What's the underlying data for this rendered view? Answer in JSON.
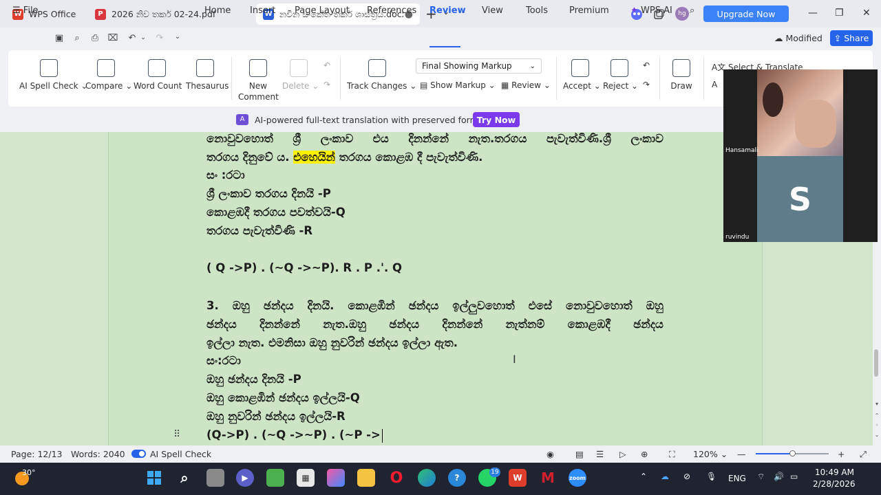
{
  "tabs": [
    {
      "label": "WPS Office",
      "icon": "wps-logo-icon",
      "color": "#e03e2d"
    },
    {
      "label": "2026 නිව තර්ක 02-24.pdf",
      "icon": "pdf-icon",
      "color": "#d9363e"
    },
    {
      "label": "නවීන සංකේත තර්ක ශාස්ත්‍රය.docx",
      "icon": "word-doc-icon",
      "color": "#2b5fd9",
      "active": true
    }
  ],
  "header": {
    "avatar_initials": "hg",
    "upgrade_label": "Upgrade Now"
  },
  "menu": {
    "file": "File",
    "items": [
      "Home",
      "Insert",
      "Page Layout",
      "References",
      "Review",
      "View",
      "Tools",
      "Premium"
    ],
    "active": "Review",
    "wps_ai": "WPS AI",
    "modified": "Modified",
    "share": "Share"
  },
  "ribbon": {
    "spell_check": "AI Spell Check",
    "compare": "Compare",
    "word_count": "Word Count",
    "thesaurus": "Thesaurus",
    "new_comment": "New\nComment",
    "new_comment_l1": "New",
    "new_comment_l2": "Comment",
    "delete": "Delete",
    "track_changes": "Track Changes",
    "markup_mode": "Final Showing Markup",
    "show_markup": "Show Markup",
    "review": "Review",
    "accept": "Accept",
    "reject": "Reject",
    "draw": "Draw",
    "select_translate": "Select & Translate"
  },
  "banner": {
    "text": "AI-powered full-text translation with preserved formatting.",
    "button": "Try Now"
  },
  "document": {
    "line1": [
      "නොවුවහොත්",
      "ශ්‍රී",
      "ලංකාව",
      "එය",
      "දිනන්නේ",
      "නැත.තරගය",
      "පැවැත්විණි.ශ්‍රී",
      "ලංකාව"
    ],
    "line2_pre": "තරගය දිනුවේ ය. ",
    "line2_hl": "එහෙයින්",
    "line2_post": " තරගය කොළඹ දී පැවැත්විණි.",
    "line3": "සං :රටා",
    "line4": "ශ්‍රී ලංකාව තරගය දිනයි -P",
    "line5": "කොළඹදී තරගය පවත්වයි-Q",
    "line6": "තරගය පැවැත්විණි  -R",
    "line7": "( Q ->P) . (~Q ->~P). R . P .'. Q",
    "line8": [
      "3.",
      "ඔහු",
      "ඡන්දය",
      "දිනයි.",
      "කොළඹින්",
      "ඡන්දය",
      "ඉල්ලුවහොත්",
      "එසේ",
      "නොවුවහොත්",
      "ඔහු"
    ],
    "line9": [
      "ඡන්දය",
      "දිනන්නේ",
      "නැත.ඔහු",
      "ඡන්දය",
      "දිනන්නේ",
      "නැත්නම්",
      "කොළඹදී",
      "ඡන්දය"
    ],
    "line10": "ඉල්ලා නැත. එමනිසා ඔහු නුවරින් ඡන්දය ඉල්ලා ඇත.",
    "line11": "සං:රටා",
    "line12": "ඔහු ඡන්දය දිනයි -P",
    "line13": "ඔහු කොළඹින් ඡන්දය ඉල්ලයි-Q",
    "line14": "ඔහු නුවරින් ඡන්දය ඉල්ලයි-R",
    "line15": "(Q->P)  . (~Q ->~P) . (~P ->"
  },
  "video": {
    "participant1": "Hansamali",
    "participant2": "ruvindu",
    "participant2_initial": "S"
  },
  "status": {
    "page": "Page: 12/13",
    "words": "Words: 2040",
    "spell": "AI Spell Check",
    "zoom": "120%",
    "zoom_fraction": 0.5
  },
  "taskbar": {
    "weather": "30°",
    "whatsapp_badge": "19",
    "lang": "ENG",
    "time": "10:49 AM",
    "date": "2/28/2026",
    "zoom_app": "zoom"
  },
  "colors": {
    "accent": "#2563eb",
    "upgrade": "#3b82f6",
    "trynow": "#7c3aed",
    "highlight": "#fff200",
    "doc_bg": "#cde4c5"
  }
}
